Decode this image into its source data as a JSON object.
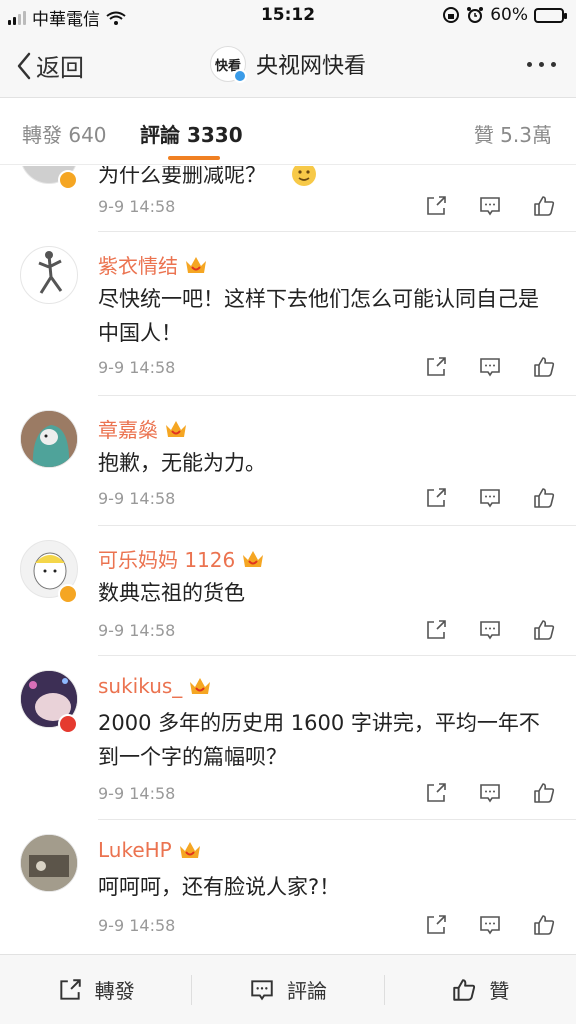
{
  "status_bar": {
    "carrier": "中華電信",
    "time": "15:12",
    "battery_percent": "60%",
    "battery_level": 0.6
  },
  "nav": {
    "back_label": "返回",
    "avatar_text": "快看",
    "title": "央视网快看"
  },
  "tabs": {
    "forward": "轉發 640",
    "comments": "評論 3330",
    "likes": "贊 5.3萬"
  },
  "comments": [
    {
      "username": "",
      "text": "为什么要删减呢？",
      "time": "9-9 14:58"
    },
    {
      "username": "紫衣情结",
      "text": "尽快统一吧！这样下去他们怎么可能认同自己是中国人！",
      "time": "9-9 14:58"
    },
    {
      "username": "章嘉燊",
      "text": "抱歉，无能为力。",
      "time": "9-9 14:58"
    },
    {
      "username": "可乐妈妈 1126",
      "text": "数典忘祖的货色",
      "time": "9-9 14:58"
    },
    {
      "username": "sukikus_",
      "text": "2000 多年的历史用 1600 字讲完，平均一年不到一个字的篇幅呗？",
      "time": "9-9 14:58"
    },
    {
      "username": "LukeHP",
      "text": "呵呵呵，还有脸说人家?！",
      "time": "9-9 14:58"
    }
  ],
  "toolbar": {
    "forward": "轉發",
    "comment": "評論",
    "like": "贊"
  },
  "colors": {
    "accent": "#f08022",
    "username": "#eb7350",
    "verified_gold": "#f5a623",
    "verified_blue": "#3a9be8"
  }
}
